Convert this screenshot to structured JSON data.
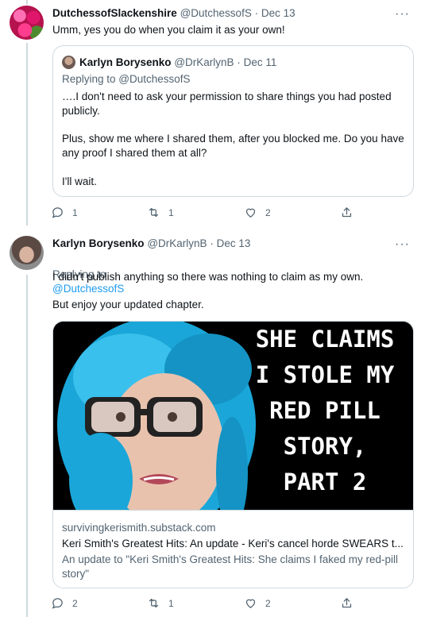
{
  "tweet1": {
    "name": "DutchessofSlackenshire",
    "handle": "@DutchessofS",
    "separator": "·",
    "date": "Dec 13",
    "text": "Umm, yes you do when you claim it as your own!",
    "more": "···",
    "quote": {
      "name": "Karlyn Borysenko",
      "handle": "@DrKarlynB",
      "separator": "·",
      "date": "Dec 11",
      "replying": "Replying to @DutchessofS",
      "para1": "….I don't need to ask your permission to share things you had posted publicly.",
      "para2": "Plus, show me where I shared them, after you blocked me. Do you have any proof I shared them at all?",
      "para3": "I'll wait."
    },
    "actions": {
      "replies": "1",
      "retweets": "1",
      "likes": "2"
    }
  },
  "tweet2": {
    "name": "Karlyn Borysenko",
    "handle": "@DrKarlynB",
    "separator": "·",
    "date": "Dec 13",
    "more": "···",
    "replying_prefix": "Replying to",
    "replying_handle": "@DutchessofS",
    "para1": "I didn't publish anything so there was nothing to claim as my own.",
    "para2": "But enjoy your updated chapter.",
    "card": {
      "image_text": "SHE CLAIMS\nI STOLE MY\nRED PILL\nSTORY,\nPART 2",
      "domain": "survivingkerismith.substack.com",
      "title": "Keri Smith's Greatest Hits: An update - Keri's cancel horde SWEARS t...",
      "description": "An update to \"Keri Smith's Greatest Hits: She claims I faked my red-pill story\""
    },
    "actions": {
      "replies": "2",
      "retweets": "1",
      "likes": "2"
    }
  },
  "colors": {
    "accent": "#1d9bf0",
    "muted": "#536471",
    "border": "#cfd9de",
    "wig": "#1aa6d8"
  },
  "icons": [
    "reply-icon",
    "retweet-icon",
    "like-icon",
    "share-icon",
    "more-icon"
  ]
}
